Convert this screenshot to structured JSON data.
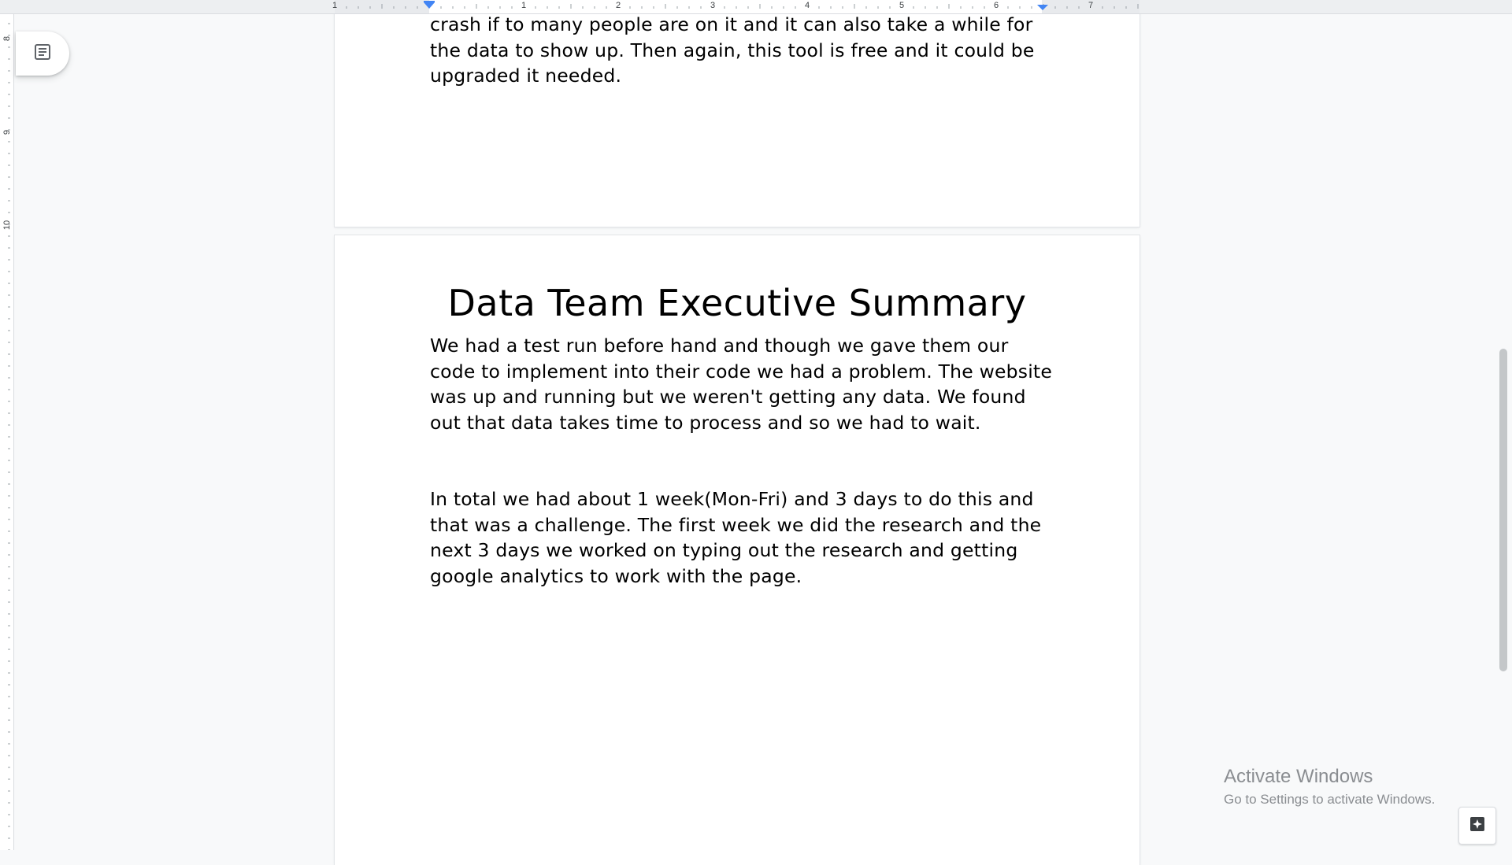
{
  "ruler": {
    "horizontal_numbers": [
      "1",
      "1",
      "2",
      "3",
      "4",
      "5",
      "6",
      "7"
    ],
    "vertical_numbers": [
      "8",
      "9",
      "10"
    ]
  },
  "outline_button": {
    "icon": "outline-list-icon"
  },
  "page1": {
    "text": "crash if to many people are on it and it can also take a while for the data to show up. Then again, this tool is free and it could be upgraded it needed."
  },
  "page2": {
    "title": "Data Team Executive Summary",
    "paragraph1": "We had a test run before hand and though we gave them our code to implement into their code we had a problem. The website was up and running but we weren't getting any data. We found out that data takes time to process and so we had to wait.",
    "paragraph2": "In total we had about 1 week(Mon-Fri) and 3 days to do this and that was a challenge. The first week we did the research and the next 3 days we worked on typing out the research and getting google analytics to work with the page."
  },
  "watermark": {
    "title": "Activate Windows",
    "subtitle": "Go to Settings to activate Windows."
  },
  "explore": {
    "icon": "explore-icon"
  },
  "colors": {
    "ruler_marker": "#4285f4",
    "page_bg": "#ffffff",
    "canvas_bg": "#f8f9fa"
  }
}
